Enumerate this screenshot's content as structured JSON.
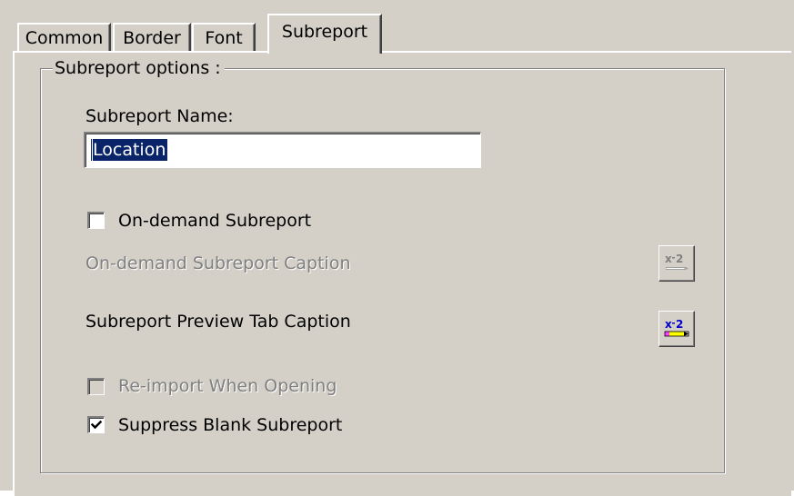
{
  "tabs": [
    {
      "label": "Common",
      "active": false
    },
    {
      "label": "Border",
      "active": false
    },
    {
      "label": "Font",
      "active": false
    },
    {
      "label": "Subreport",
      "active": true
    }
  ],
  "group": {
    "title": "Subreport options :"
  },
  "subreport_name": {
    "label": "Subreport Name:",
    "value": "Location"
  },
  "on_demand": {
    "label": "On-demand Subreport",
    "checked": false
  },
  "on_demand_caption": {
    "label": "On-demand Subreport Caption",
    "enabled": false,
    "button_icon": "formula-x2-icon"
  },
  "preview_tab_caption": {
    "label": "Subreport Preview Tab Caption",
    "button_icon": "formula-x2-pencil-icon"
  },
  "reimport": {
    "label": "Re-import When Opening",
    "checked": false,
    "enabled": false
  },
  "suppress_blank": {
    "label": "Suppress Blank Subreport",
    "checked": true
  },
  "colors": {
    "face": "#d4d0c8",
    "selection": "#0a246a",
    "disabled_text": "#808080"
  }
}
